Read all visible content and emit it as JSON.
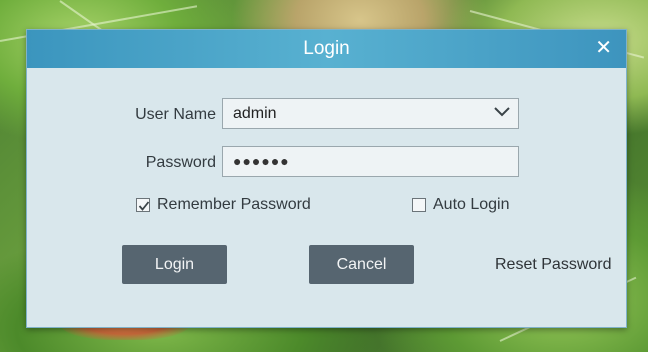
{
  "dialog": {
    "title": "Login",
    "close_glyph": "✕"
  },
  "form": {
    "username_label": "User Name",
    "username_value": "admin",
    "password_label": "Password",
    "password_value": "●●●●●●",
    "remember_label": "Remember Password",
    "remember_checked": true,
    "auto_login_label": "Auto Login",
    "auto_login_checked": false
  },
  "buttons": {
    "login_label": "Login",
    "cancel_label": "Cancel",
    "reset_label": "Reset Password"
  },
  "colors": {
    "titlebar": "#3b95be",
    "dialog_bg": "#d9e7ec",
    "button_bg": "#566570"
  },
  "icons": {
    "close": "close-icon",
    "dropdown": "chevron-down-icon",
    "checkbox_checked": "checkmark-icon"
  }
}
